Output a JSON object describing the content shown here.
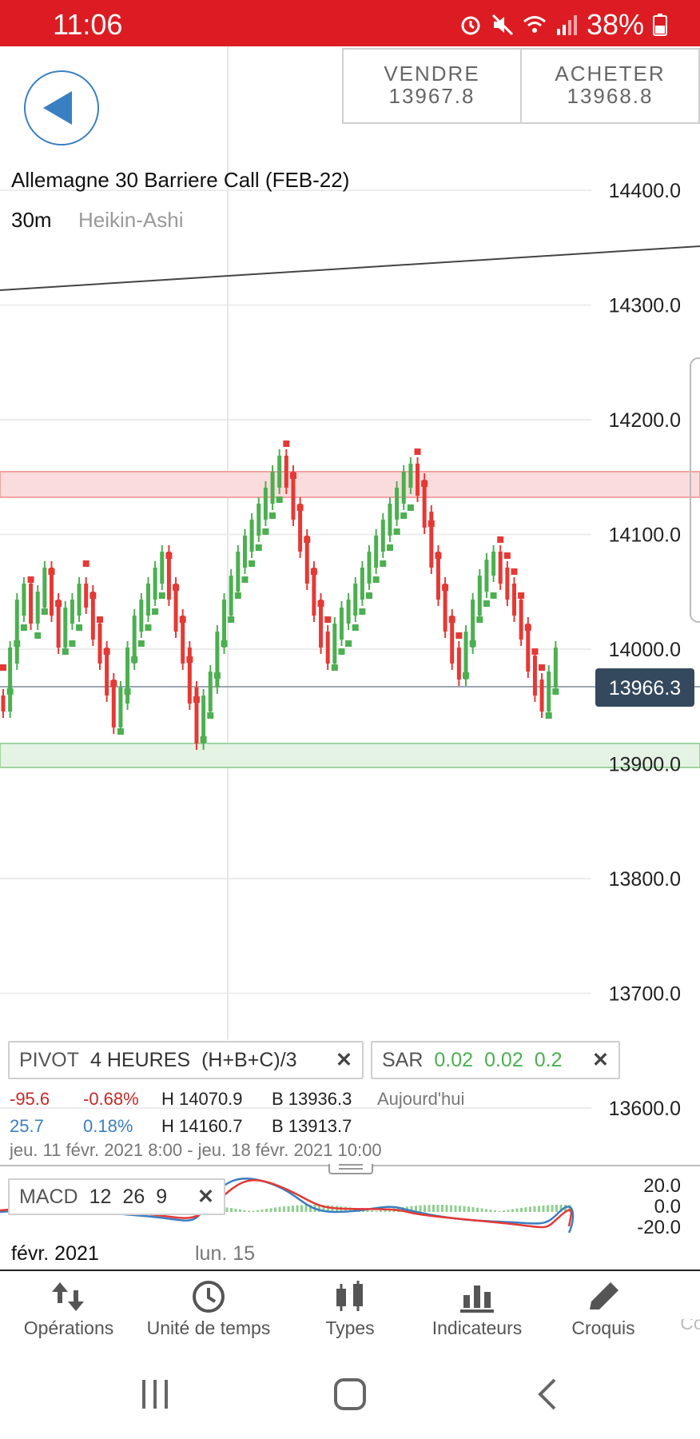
{
  "status": {
    "time": "11:06",
    "battery": "38%"
  },
  "trade": {
    "sell_label": "VENDRE",
    "sell_price": "13967.8",
    "buy_label": "ACHETER",
    "buy_price": "13968.8"
  },
  "chart": {
    "title": "Allemagne 30 Barriere Call (FEB-22)",
    "timeframe": "30m",
    "type": "Heikin-Ashi",
    "current_price": "13966.3",
    "price_ticks": [
      "14400.0",
      "14300.0",
      "14200.0",
      "14100.0",
      "14000.0",
      "13900.0",
      "13800.0",
      "13700.0",
      "13600.0"
    ],
    "colors": {
      "up": "#4caf50",
      "down": "#e53935",
      "accent": "#dc1c22",
      "price_tag": "#34495e"
    }
  },
  "indicators": {
    "pivot": {
      "name": "PIVOT",
      "period": "4 HEURES",
      "formula": "(H+B+C)/3"
    },
    "sar": {
      "name": "SAR",
      "p1": "0.02",
      "p2": "0.02",
      "p3": "0.2"
    },
    "stats_row1": {
      "change": "-95.6",
      "pct": "-0.68%",
      "high": "H 14070.9",
      "low": "B 13936.3",
      "label": "Aujourd'hui"
    },
    "stats_row2": {
      "change": "25.7",
      "pct": "0.18%",
      "high": "H 14160.7",
      "low": "B 13913.7"
    },
    "range": "jeu. 11 févr. 2021 8:00 - jeu. 18 févr. 2021 10:00",
    "macd": {
      "name": "MACD",
      "fast": "12",
      "slow": "26",
      "signal": "9",
      "ticks": [
        "20.0",
        "0.0",
        "-20.0"
      ]
    }
  },
  "dates": {
    "month": "févr. 2021",
    "day": "lun. 15"
  },
  "nav": {
    "operations": "Opérations",
    "timeframe": "Unité de temps",
    "types": "Types",
    "indicators": "Indicateurs",
    "drawings": "Croquis",
    "more": "Co"
  }
}
